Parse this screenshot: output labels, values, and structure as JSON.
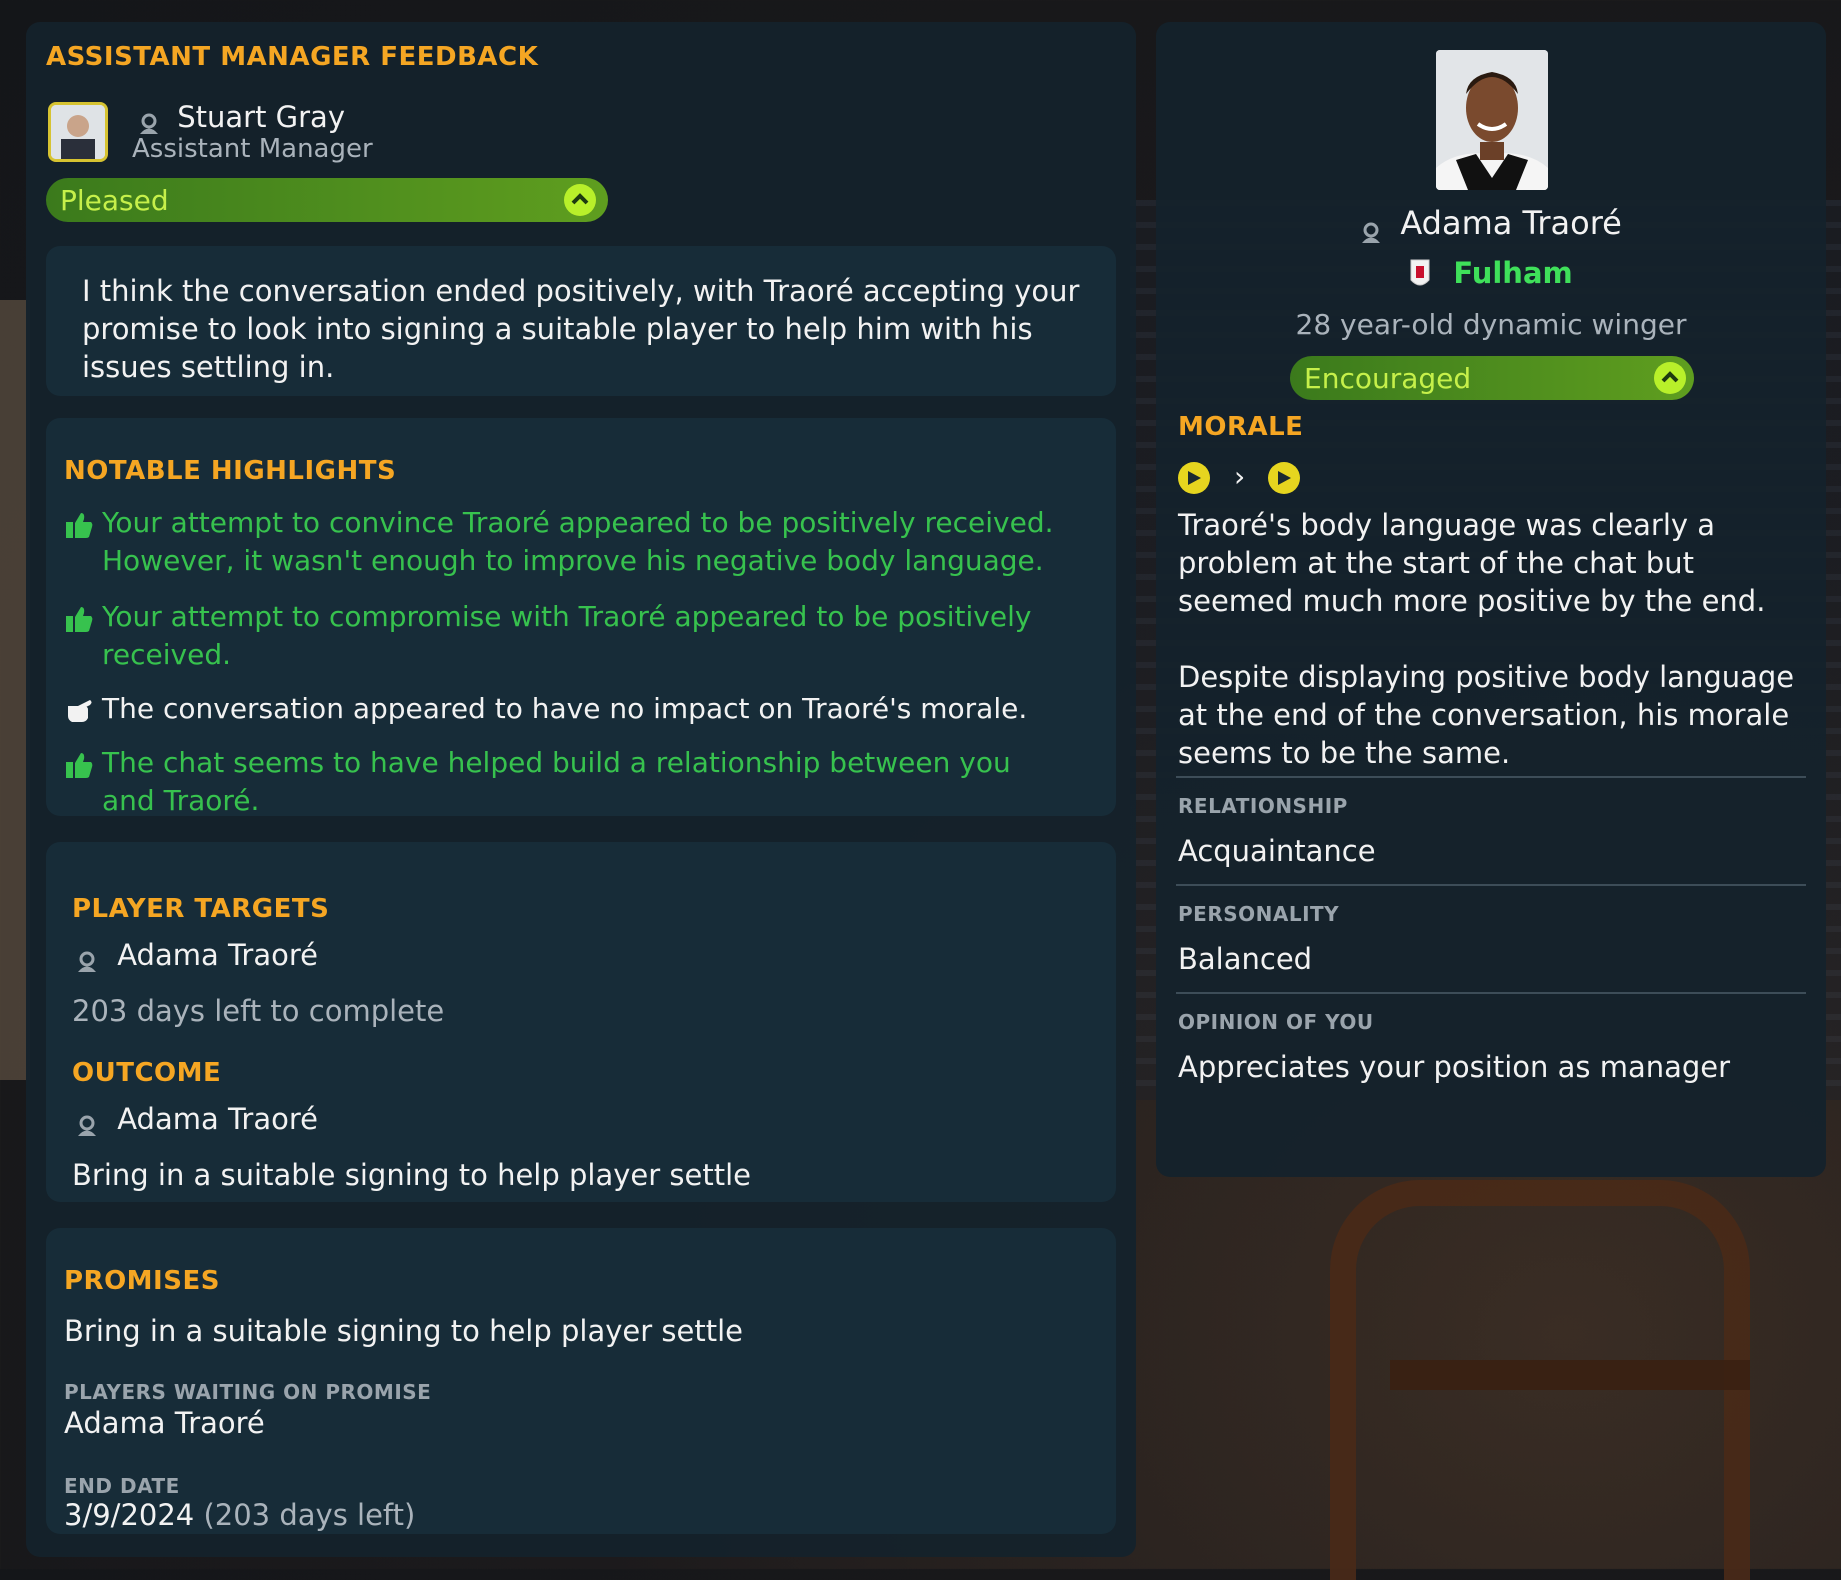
{
  "feedback": {
    "heading": "ASSISTANT MANAGER FEEDBACK",
    "staff_name": "Stuart Gray",
    "staff_role": "Assistant Manager",
    "mood": "Pleased",
    "quote": "I think the conversation ended positively, with Traoré accepting your promise to look into signing a suitable player to help him with his issues settling in."
  },
  "highlights": {
    "heading": "NOTABLE HIGHLIGHTS",
    "items": [
      {
        "icon": "thumbs-up-icon",
        "tone": "positive",
        "text": "Your attempt to convince Traoré appeared to be positively received. However, it wasn't enough to improve his negative body language."
      },
      {
        "icon": "thumbs-up-icon",
        "tone": "positive",
        "text": "Your attempt to compromise with Traoré appeared to be positively received."
      },
      {
        "icon": "thumbs-sideways-icon",
        "tone": "neutral",
        "text": "The conversation appeared to have no impact on Traoré's morale."
      },
      {
        "icon": "thumbs-up-icon",
        "tone": "positive",
        "text": "The chat seems to have helped build a relationship between you and Traoré."
      }
    ]
  },
  "targets": {
    "heading": "PLAYER TARGETS",
    "player": "Adama Traoré",
    "days_left": "203 days left to complete",
    "outcome_heading": "OUTCOME",
    "outcome_player": "Adama Traoré",
    "outcome_text": "Bring in a suitable signing to help player settle"
  },
  "promises": {
    "heading": "PROMISES",
    "text": "Bring in a suitable signing to help player settle",
    "waiting_label": "PLAYERS WAITING ON PROMISE",
    "waiting_player": "Adama Traoré",
    "end_label": "END DATE",
    "end_date": "3/9/2024",
    "end_days": "(203 days left)"
  },
  "player": {
    "name": "Adama Traoré",
    "club": "Fulham",
    "description": "28 year-old dynamic winger",
    "mood": "Encouraged",
    "morale_heading": "MORALE",
    "morale_text_1": "Traoré's body language was clearly a problem at the start of the chat but seemed much more positive by the end.",
    "morale_text_2": "Despite displaying positive body language at the end of the conversation, his morale seems to be the same.",
    "relationship_label": "RELATIONSHIP",
    "relationship": "Acquaintance",
    "personality_label": "PERSONALITY",
    "personality": "Balanced",
    "opinion_label": "OPINION OF YOU",
    "opinion": "Appreciates your position as manager"
  },
  "colors": {
    "accent": "#f5a623",
    "positive": "#37c24e",
    "mood_bar": "#5f9e1f",
    "panel": "#14222c"
  }
}
